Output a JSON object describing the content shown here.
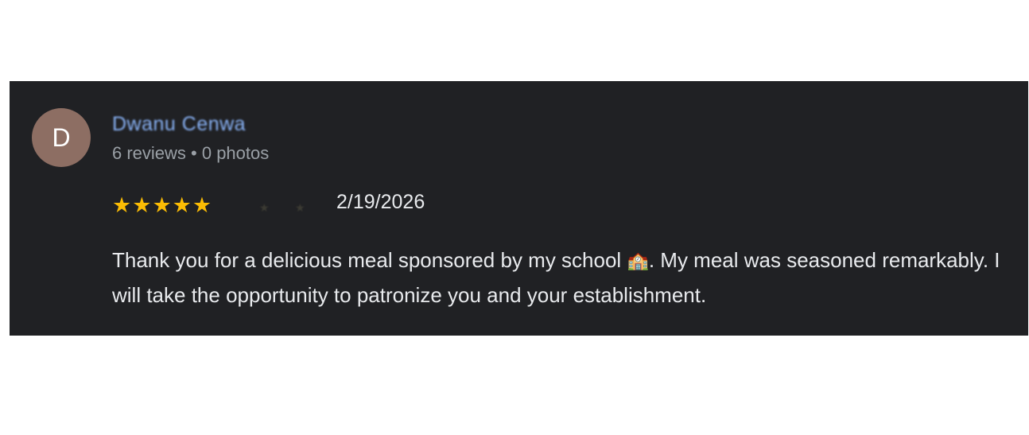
{
  "review": {
    "avatar_initial": "D",
    "avatar_color": "#8d6e63",
    "reviewer_name": "Dwanu Cenwa",
    "reviewer_stats": "6 reviews • 0 photos",
    "rating": 5,
    "rating_max": 5,
    "star_glyph": "★",
    "date": "2/19/2026",
    "text_part1": "Thank you for a delicious meal sponsored by my school ",
    "school_icon": "school-icon",
    "school_glyph": "🏫",
    "text_part2": ". My meal was seasoned remarkably. I will take the opportunity to patronize you and your establishment.",
    "colors": {
      "card_background": "#202124",
      "name": "#8ab4f8",
      "meta": "#9aa0a6",
      "star": "#fbbc04",
      "text": "#e8eaed"
    }
  }
}
